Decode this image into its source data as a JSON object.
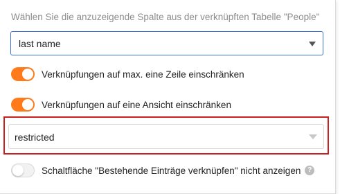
{
  "column_hint": "Wählen Sie die anzuzeigende Spalte aus der verknüpften Tabelle \"People\"",
  "column_select": {
    "value": "last name"
  },
  "toggles": [
    {
      "label": "Verknüpfungen auf max. eine Zeile einschränken",
      "state": "on"
    },
    {
      "label": "Verknüpfungen auf eine Ansicht einschränken",
      "state": "on"
    },
    {
      "label": "Schaltfläche \"Bestehende Einträge verknüpfen\" nicht anzeigen",
      "state": "off"
    }
  ],
  "view_select": {
    "value": "restricted"
  },
  "help_icon_glyph": "?",
  "colors": {
    "accent_orange": "#ff7a1a",
    "focus_blue": "#3a6fd6",
    "highlight_red": "#cc2020"
  }
}
